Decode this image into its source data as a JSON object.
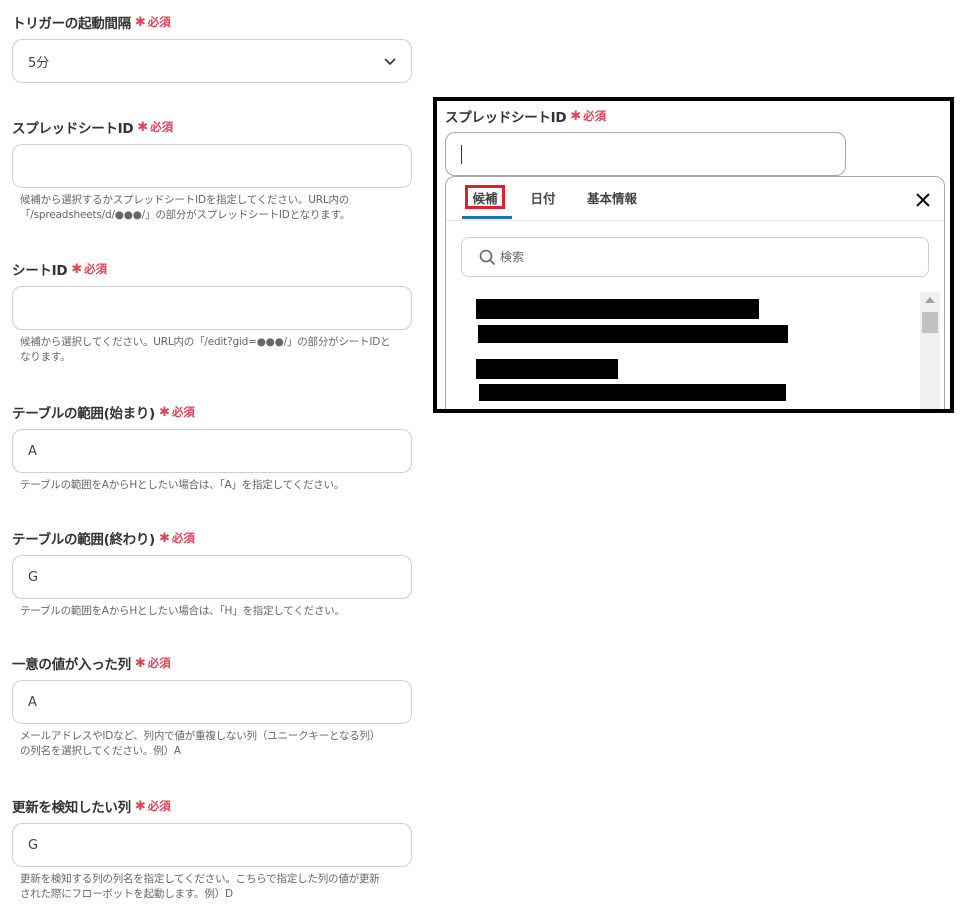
{
  "required_text": "必須",
  "required_star": "✱",
  "fields": [
    {
      "label": "トリガーの起動間隔",
      "value": "5分",
      "type": "select"
    },
    {
      "label": "スプレッドシートID",
      "value": "",
      "help": [
        "候補から選択するかスプレッドシートIDを指定してください。URL内の",
        "「/spreadsheets/d/●●●/」の部分がスプレッドシートIDとなります。"
      ]
    },
    {
      "label": "シートID",
      "value": "",
      "help": [
        "候補から選択してください。URL内の「/edit?gid=●●●/」の部分がシートIDと",
        "なります。"
      ]
    },
    {
      "label": "テーブルの範囲(始まり)",
      "value": "A",
      "help": [
        "テーブルの範囲をAからHとしたい場合は、「A」を指定してください。"
      ]
    },
    {
      "label": "テーブルの範囲(終わり)",
      "value": "G",
      "help": [
        "テーブルの範囲をAからHとしたい場合は、「H」を指定してください。"
      ]
    },
    {
      "label": "一意の値が入った列",
      "value": "A",
      "help": [
        "メールアドレスやIDなど、列内で値が重複しない列（ユニークキーとなる列）",
        "の列名を選択してください。例）A"
      ]
    },
    {
      "label": "更新を検知したい列",
      "value": "G",
      "help": [
        "更新を検知する列の列名を指定してください。こちらで指定した列の値が更新",
        "された際にフローボットを起動します。例）D"
      ]
    }
  ],
  "overlay": {
    "label": "スプレッドシートID",
    "tabs": [
      "候補",
      "日付",
      "基本情報"
    ],
    "active_tab": "候補",
    "search_placeholder": "検索"
  },
  "colors": {
    "required": "#e0445b",
    "tab_highlight": "#e51e2b",
    "tab_underline": "#1d6fb8",
    "redaction": "#000000"
  }
}
